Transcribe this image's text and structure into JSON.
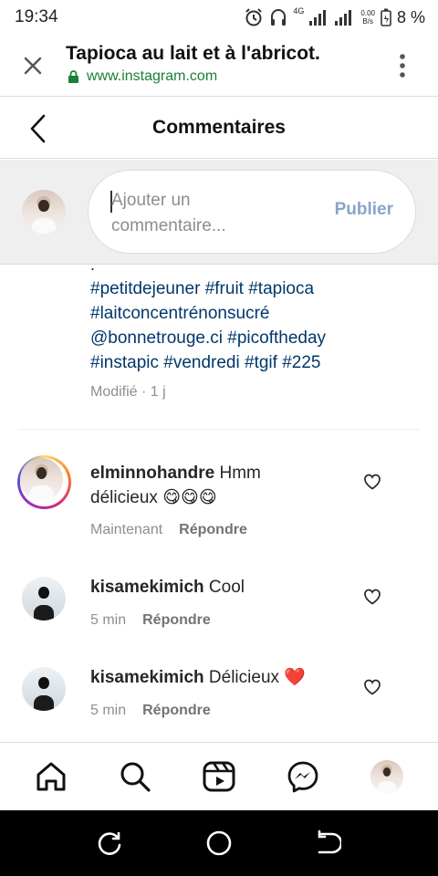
{
  "status_bar": {
    "time": "19:34",
    "network": "4G",
    "data_rate_top": "0.00",
    "data_rate_bottom": "B/s",
    "battery": "8 %"
  },
  "browser": {
    "title": "Tapioca au lait et à l'abricot.",
    "url": "www.instagram.com"
  },
  "header": {
    "title": "Commentaires"
  },
  "composer": {
    "placeholder": "Ajouter un commentaire...",
    "publish_label": "Publier"
  },
  "caption": {
    "leading_text": ".",
    "hashtags": "#petitdejeuner #fruit #tapioca #laitconcentrénonsucré @bonnetrouge.ci #picoftheday #instapic #vendredi #tgif #225",
    "meta": "Modifié · 1 j"
  },
  "comments": [
    {
      "username": "elminnohandre",
      "text": "Hmm délicieux 😋😋😋",
      "time": "Maintenant",
      "reply_label": "Répondre"
    },
    {
      "username": "kisamekimich",
      "text": "Cool",
      "time": "5 min",
      "reply_label": "Répondre"
    },
    {
      "username": "kisamekimich",
      "text": "Délicieux ❤️",
      "time": "5 min",
      "reply_label": "Répondre"
    }
  ],
  "icons": {
    "browser_close": "close-icon",
    "browser_menu": "more-vertical-icon",
    "lock": "lock-icon",
    "back": "chevron-left-icon",
    "like": "heart-icon",
    "nav": [
      "home-icon",
      "search-icon",
      "reels-icon",
      "messenger-icon",
      "profile-avatar"
    ],
    "system_nav": [
      "recent-apps-icon",
      "home-circle-icon",
      "back-icon"
    ]
  },
  "colors": {
    "link": "#00376b",
    "publish": "#8aa5c8",
    "secure_url": "#1a7f37",
    "like_heart": "#ed4956"
  }
}
